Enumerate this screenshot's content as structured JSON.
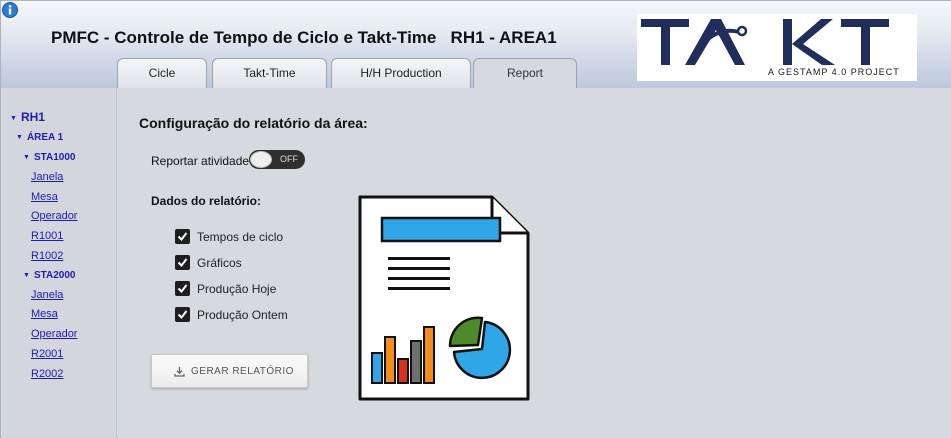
{
  "header": {
    "title": "PMFC - Controle de Tempo de Ciclo e Takt-Time   RH1 - AREA1",
    "logo_text": "TAKT",
    "logo_subtitle": "A GESTAMP 4.0 PROJECT",
    "info_icon": "info-icon"
  },
  "tabs": [
    {
      "label": "Cicle"
    },
    {
      "label": "Takt-Time"
    },
    {
      "label": "H/H Production"
    },
    {
      "label": "Report",
      "active": true
    }
  ],
  "sidebar": {
    "root": "RH1",
    "area": "ÁREA 1",
    "stations": [
      {
        "label": "STA1000",
        "children": [
          "Janela",
          "Mesa",
          "Operador",
          "R1001",
          "R1002"
        ]
      },
      {
        "label": "STA2000",
        "children": [
          "Janela",
          "Mesa",
          "Operador",
          "R2001",
          "R2002"
        ]
      }
    ]
  },
  "main": {
    "section_title": "Configuração do relatório da área:",
    "report_activity_label": "Reportar atividade",
    "toggle_state": "OFF",
    "data_label": "Dados do relatório:",
    "options": [
      {
        "label": "Tempos de ciclo",
        "checked": true
      },
      {
        "label": "Gráficos",
        "checked": true
      },
      {
        "label": "Produção Hoje",
        "checked": true
      },
      {
        "label": "Produção Ontem",
        "checked": true
      }
    ],
    "generate_button": "GERAR RELATÓRIO",
    "generate_icon": "download-icon"
  },
  "colors": {
    "accent_blue": "#1d1db0",
    "logo_navy": "#1f2e5a",
    "bar_blue": "#2fa6e6",
    "bar_orange": "#f28c1b",
    "bar_red": "#d7321e",
    "bar_gray": "#6f6f6f",
    "pie_green": "#4e8a2a"
  }
}
